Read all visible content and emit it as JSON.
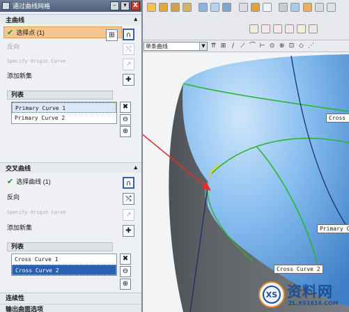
{
  "dialog": {
    "title": "通过曲线网格",
    "controls": {
      "minimize": "–",
      "menu": "▾",
      "close": "X"
    }
  },
  "primary": {
    "header": "主曲线",
    "select_label": "选择点",
    "select_count": "(1)",
    "reverse": "反向",
    "specify_origin": "Specify Origin Curve",
    "add_new_set": "添加新集",
    "list_header": "列表",
    "items": [
      "Primary Curve  1",
      "Primary Curve  2"
    ]
  },
  "cross": {
    "header": "交叉曲线",
    "select_label": "选择曲线",
    "select_count": "(1)",
    "reverse": "反向",
    "specify_origin": "Specify Origin Curve",
    "add_new_set": "添加新集",
    "list_header": "列表",
    "items": [
      "Cross Curve  1",
      "Cross Curve  2"
    ]
  },
  "continuity": {
    "header": "连续性"
  },
  "output_surface": {
    "header": "输出曲面选项"
  },
  "toolbar": {
    "filter_value": "单条曲线"
  },
  "viewport_labels": {
    "cross_top": "Cross Cu",
    "primary_right": "Primary Cu",
    "cross_bottom": "Cross Curve  2"
  },
  "watermark": {
    "title": "资料网",
    "url": "ZL.XS1616.COM",
    "badge": "XS"
  },
  "colors": {
    "accent_select": "#f5c68e",
    "list_selection": "#2b5fb4",
    "curve_green": "#2bb52b",
    "arrow_red": "#e0302a",
    "surface_blue": "#6aa8e6"
  }
}
